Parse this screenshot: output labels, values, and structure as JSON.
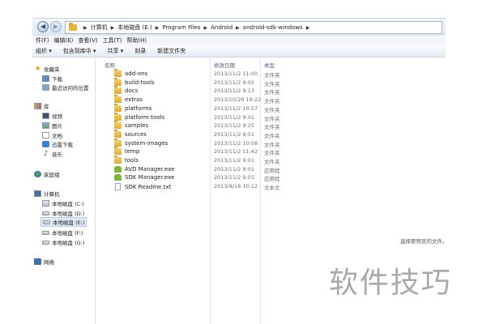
{
  "address": {
    "crumbs": [
      "计算机",
      "本地磁盘 (E:)",
      "Program Files",
      "Android",
      "android-sdk-windows"
    ]
  },
  "menu": [
    "件(F)",
    "编辑(E)",
    "查看(V)",
    "工具(T)",
    "帮助(H)"
  ],
  "toolbar": [
    "组织 ▾",
    "包含到库中 ▾",
    "共享 ▾",
    "刻录",
    "新建文件夹"
  ],
  "nav": {
    "favorites": "收藏夹",
    "downloads": "下载",
    "recent": "最近访问的位置",
    "libraries": "库",
    "videos": "视频",
    "pictures": "图片",
    "documents": "文档",
    "thunder": "迅雷下载",
    "music": "音乐",
    "homegroup": "家庭组",
    "computer": "计算机",
    "drive_c": "本地磁盘 (C:)",
    "drive_d": "本地磁盘 (D:)",
    "drive_e": "本地磁盘 (E:)",
    "drive_f": "本地磁盘 (F:)",
    "drive_g": "本地磁盘 (G:)",
    "network": "网络"
  },
  "columns": {
    "name": "名称",
    "date": "修改日期",
    "type": "类型"
  },
  "files": [
    {
      "name": "add-ons",
      "date": "2013/11/2 11:00",
      "type": "文件夹",
      "icon": "folder-icon"
    },
    {
      "name": "build-tools",
      "date": "2013/11/2 9:02",
      "type": "文件夹",
      "icon": "folder-icon"
    },
    {
      "name": "docs",
      "date": "2013/11/2 9:13",
      "type": "文件夹",
      "icon": "folder-icon"
    },
    {
      "name": "extras",
      "date": "2013/10/29 19:22",
      "type": "文件夹",
      "icon": "folder-icon"
    },
    {
      "name": "platforms",
      "date": "2013/11/2 10:57",
      "type": "文件夹",
      "icon": "folder-icon"
    },
    {
      "name": "platform-tools",
      "date": "2013/11/2 9:01",
      "type": "文件夹",
      "icon": "folder-icon"
    },
    {
      "name": "samples",
      "date": "2013/11/2 9:25",
      "type": "文件夹",
      "icon": "folder-icon"
    },
    {
      "name": "sources",
      "date": "2013/11/2 9:51",
      "type": "文件夹",
      "icon": "folder-icon"
    },
    {
      "name": "system-images",
      "date": "2013/11/2 10:08",
      "type": "文件夹",
      "icon": "folder-icon"
    },
    {
      "name": "temp",
      "date": "2013/11/2 11:42",
      "type": "文件夹",
      "icon": "folder-icon"
    },
    {
      "name": "tools",
      "date": "2013/11/2 9:01",
      "type": "文件夹",
      "icon": "folder-icon"
    },
    {
      "name": "AVD Manager.exe",
      "date": "2013/11/2 9:01",
      "type": "应用程",
      "icon": "android-app-icon"
    },
    {
      "name": "SDK Manager.exe",
      "date": "2013/11/2 9:01",
      "type": "应用程",
      "icon": "android-app-icon"
    },
    {
      "name": "SDK Readme.txt",
      "date": "2013/9/18 10:12",
      "type": "文本文",
      "icon": "text-file-icon"
    }
  ],
  "preview": {
    "message": "选择要预览的文件。"
  },
  "watermark": "软件技巧"
}
